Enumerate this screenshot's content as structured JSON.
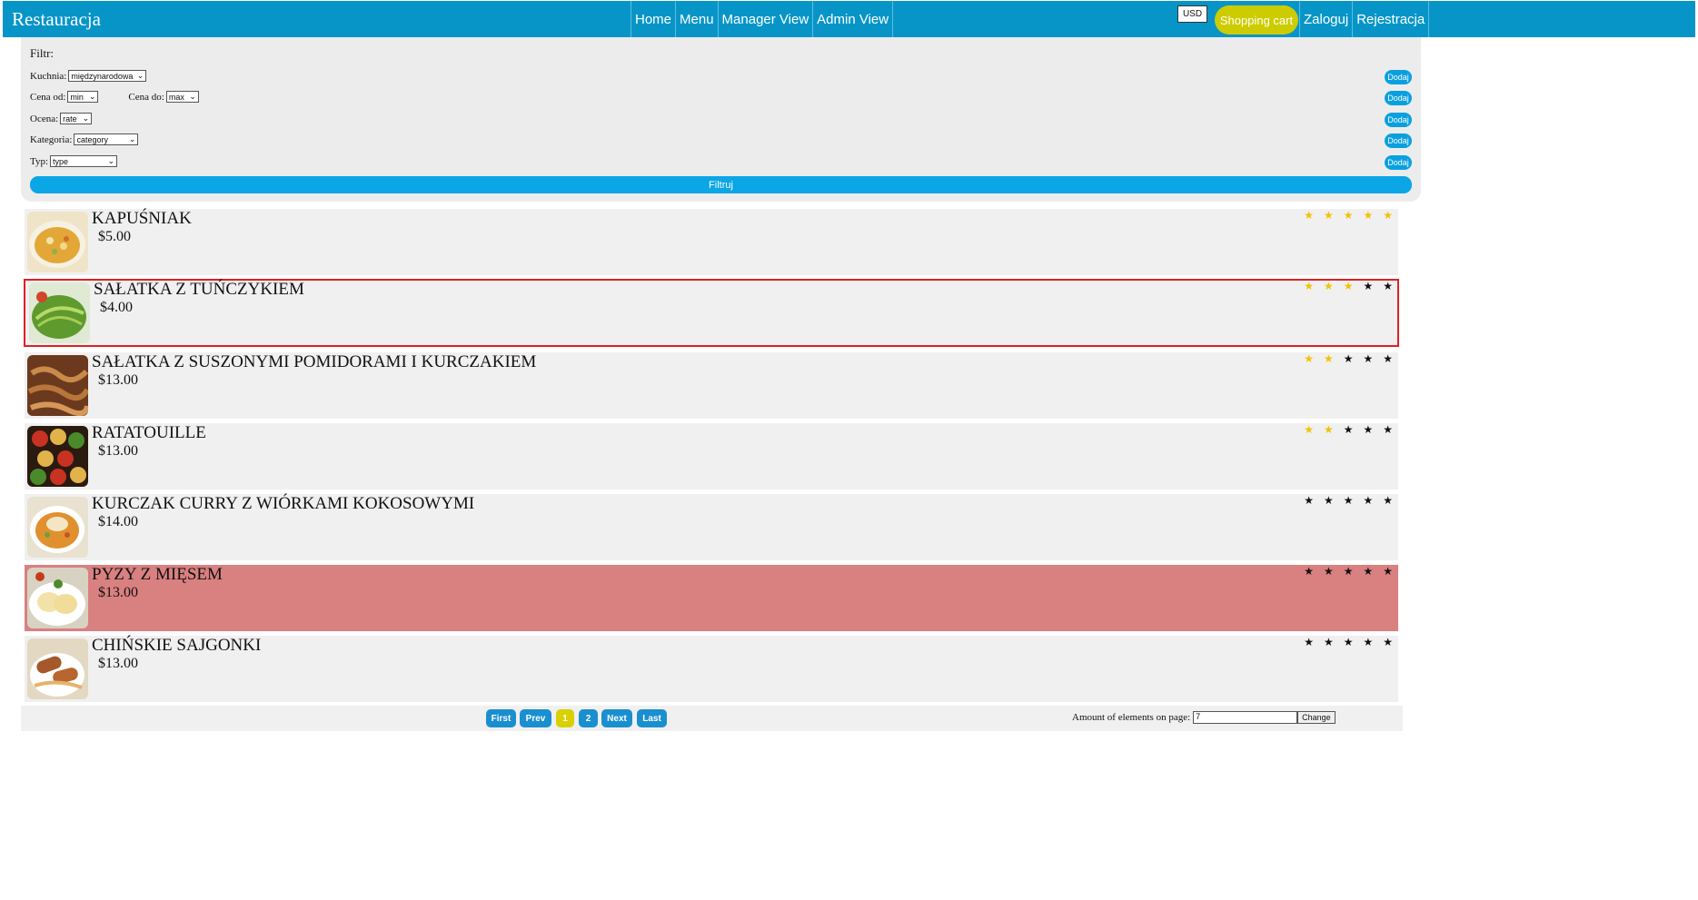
{
  "header": {
    "brand": "Restauracja",
    "nav": [
      "Home",
      "Menu",
      "Manager View",
      "Admin View"
    ],
    "currency": "USD",
    "cart": "Shopping cart",
    "auth": [
      "Zaloguj",
      "Rejestracja"
    ]
  },
  "filter": {
    "title": "Filtr:",
    "kuchnia_label": "Kuchnia:",
    "kuchnia_value": "międzynarodowa",
    "cena_od_label": "Cena od:",
    "cena_od_value": "min",
    "cena_do_label": "Cena do:",
    "cena_do_value": "max",
    "ocena_label": "Ocena:",
    "ocena_value": "rate",
    "kategoria_label": "Kategoria:",
    "kategoria_value": "category",
    "typ_label": "Typ:",
    "typ_value": "type",
    "add_label": "Dodaj",
    "submit_label": "Filtruj"
  },
  "dishes": [
    {
      "name": "KAPUŚNIAK",
      "price": "$5.00",
      "rating": 5,
      "stars_lit": "★ ★ ★ ★ ★",
      "stars_dark": ""
    },
    {
      "name": "SAŁATKA Z TUŃCZYKIEM",
      "price": "$4.00",
      "rating": 3,
      "stars_lit": "★ ★ ★ ",
      "stars_dark": "★ ★"
    },
    {
      "name": "SAŁATKA Z SUSZONYMI POMIDORAMI I KURCZAKIEM",
      "price": "$13.00",
      "rating": 2,
      "stars_lit": "★ ★ ",
      "stars_dark": "★ ★ ★"
    },
    {
      "name": "RATATOUILLE",
      "price": "$13.00",
      "rating": 2,
      "stars_lit": "★ ★ ",
      "stars_dark": "★ ★ ★"
    },
    {
      "name": "KURCZAK CURRY Z WIÓRKAMI KOKOSOWYMI",
      "price": "$14.00",
      "rating": 0,
      "stars_lit": "",
      "stars_dark": "★ ★ ★ ★ ★"
    },
    {
      "name": "PYZY Z MIĘSEM",
      "price": "$13.00",
      "rating": 0,
      "stars_lit": "",
      "stars_dark": "★ ★ ★ ★ ★"
    },
    {
      "name": "CHIŃSKIE SAJGONKI",
      "price": "$13.00",
      "rating": 0,
      "stars_lit": "",
      "stars_dark": "★ ★ ★ ★ ★"
    }
  ],
  "colors": {
    "header": "#0795c8",
    "cart": "#cccc00",
    "selected_border": "#e02020",
    "highlight_row": "#d98080",
    "star_on": "#f2c200"
  },
  "pagination": {
    "first": "First",
    "prev": "Prev",
    "page1": "1",
    "page2": "2",
    "next": "Next",
    "last": "Last",
    "amount_label": "Amount of elements on page:",
    "amount_value": "7",
    "change": "Change"
  }
}
